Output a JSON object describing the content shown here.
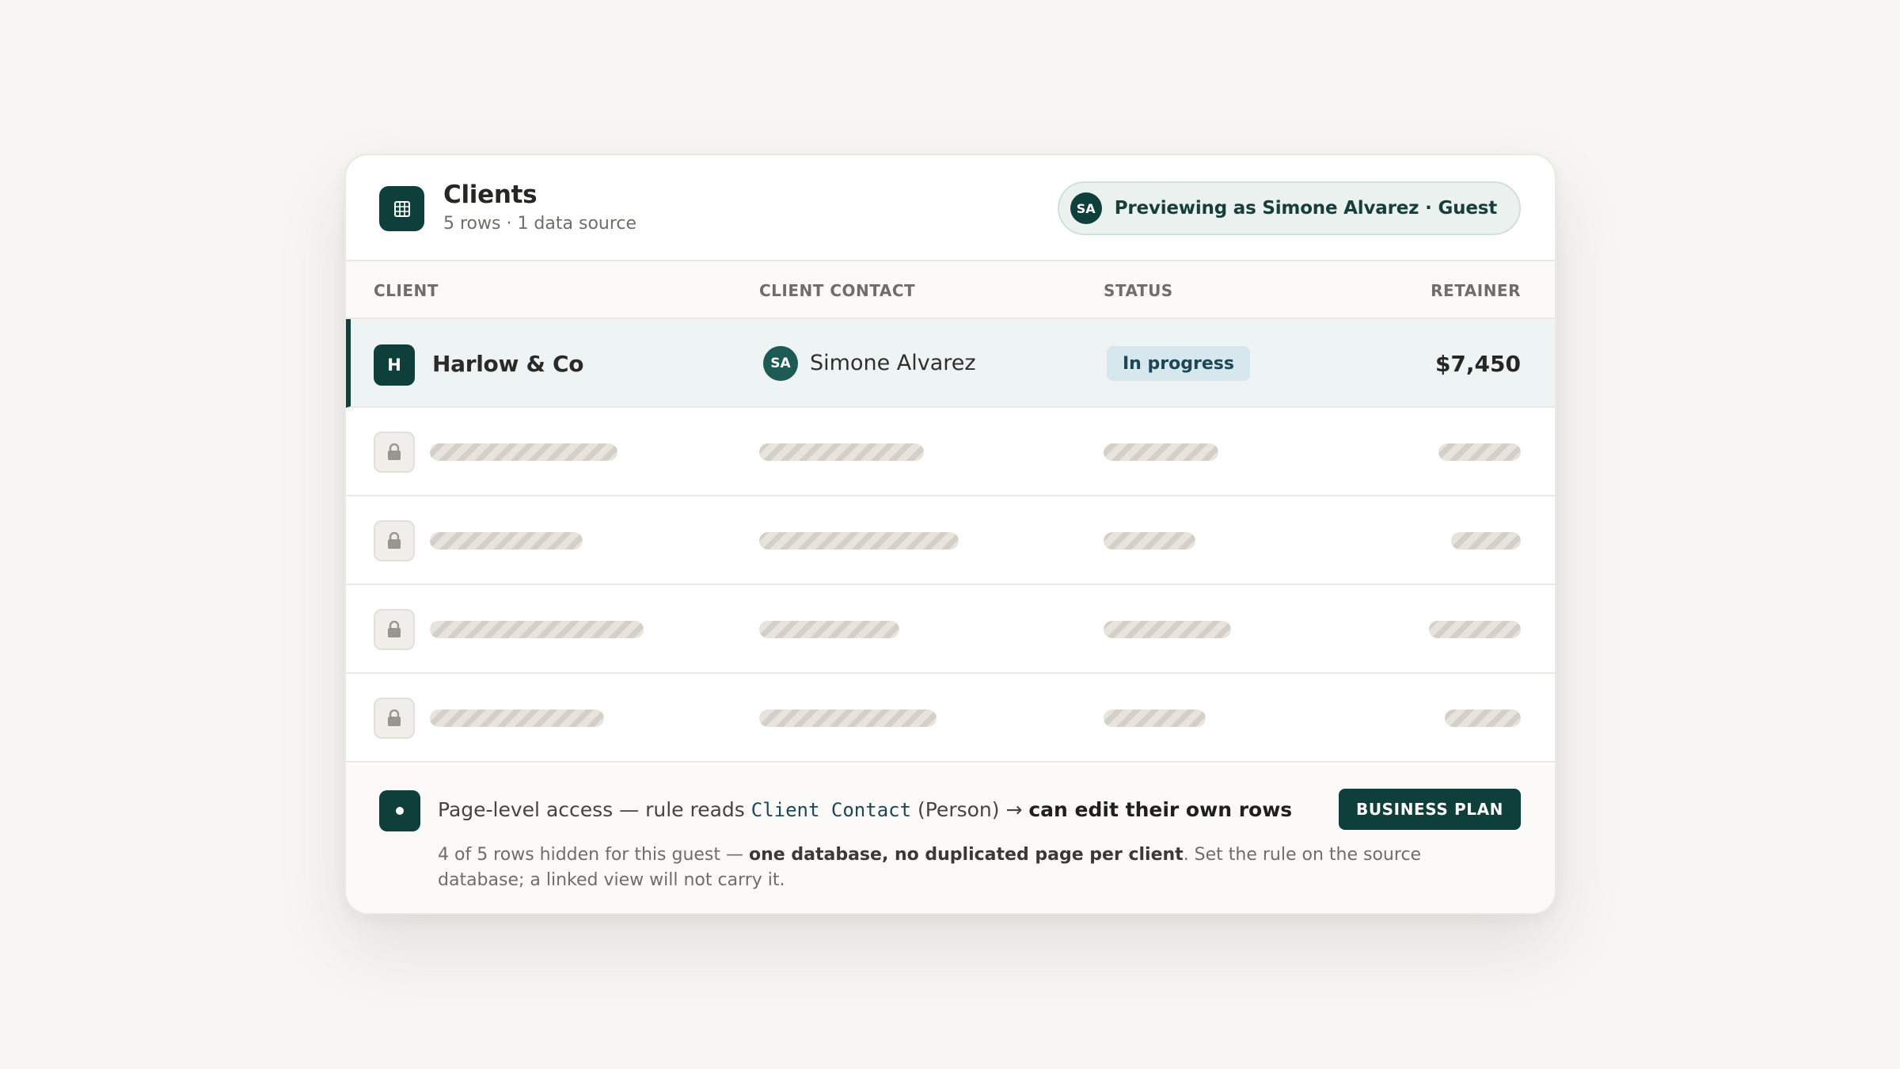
{
  "header": {
    "title": "Clients",
    "subtitle": "5 rows · 1 data source",
    "preview": {
      "initials": "SA",
      "label": "Previewing as Simone Alvarez · Guest"
    }
  },
  "table": {
    "columns": [
      "CLIENT",
      "CLIENT CONTACT",
      "STATUS",
      "RETAINER"
    ],
    "visible_row": {
      "badge": "H",
      "client": "Harlow & Co",
      "contact_initials": "SA",
      "contact": "Simone Alvarez",
      "status": "In progress",
      "retainer": "$7,450"
    },
    "locked_rows": 4
  },
  "footer": {
    "line1_prefix": "Page-level access — rule reads ",
    "line1_code": "Client Contact",
    "line1_mid": " (Person) → ",
    "line1_bold": "can edit their own rows",
    "plan_button": "BUSINESS PLAN",
    "line2_prefix": "4 of 5 rows hidden for this guest — ",
    "line2_bold": "one database, no duplicated page per client",
    "line2_suffix": ". Set the rule on the source database; a linked view will not carry it."
  },
  "colors": {
    "accent": "#0f3f3b",
    "status_bg": "#d6e7ee",
    "background": "#f7f6f3"
  },
  "icons": {
    "database": "table-grid-icon",
    "locked": "lock-icon",
    "footer": "dot-icon"
  }
}
